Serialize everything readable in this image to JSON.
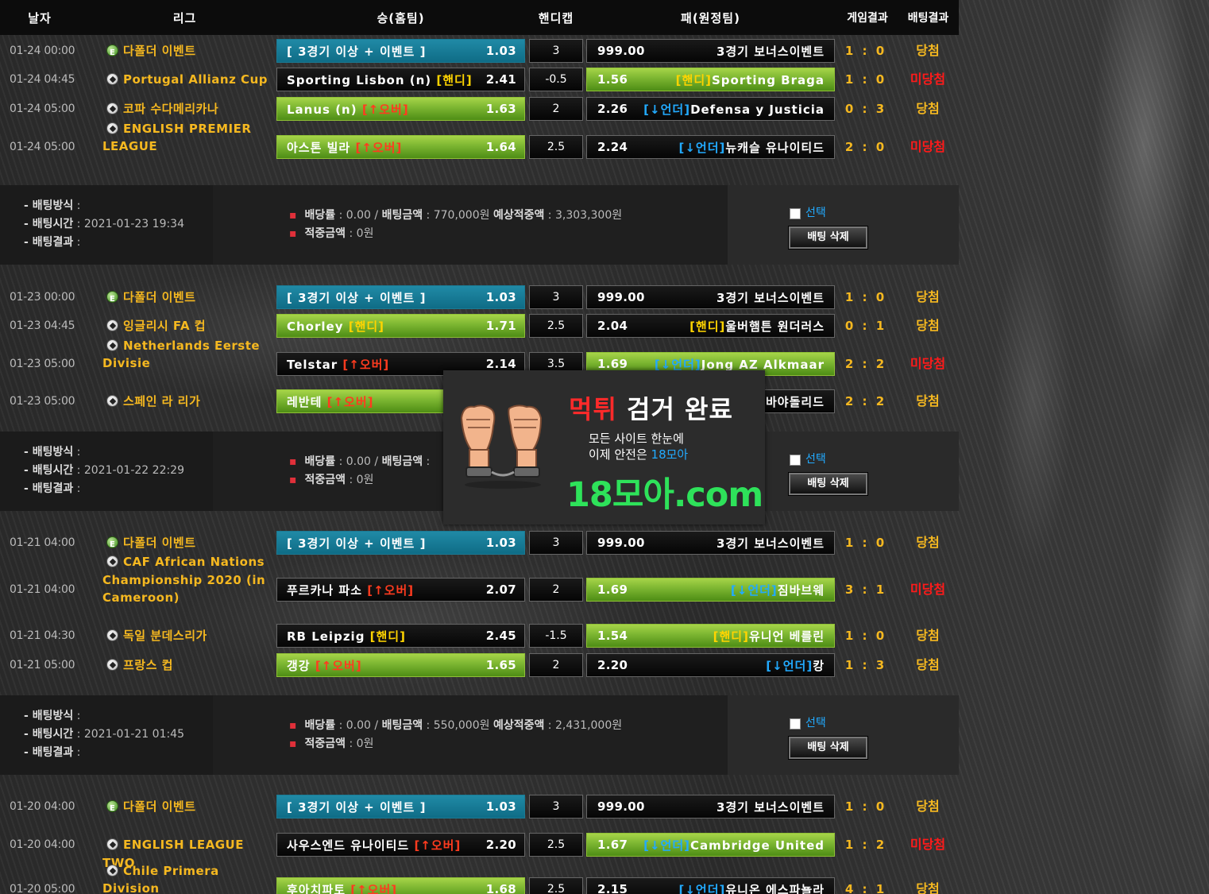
{
  "header": {
    "date": "날자",
    "league": "리그",
    "home": "승(홈팀)",
    "handicap": "핸디캡",
    "away": "패(원정팀)",
    "game_result": "게임결과",
    "bet_result": "배팅결과"
  },
  "groups": [
    {
      "rows": [
        {
          "date": "01-24 00:00",
          "league": "다폴더 이벤트",
          "icon": "event",
          "home": "[ 3경기 이상 + 이벤트 ]",
          "home_tag": "",
          "home_tag_color": "",
          "home_odds": "1.03",
          "home_style": "blue",
          "hc": "3",
          "away_odds": "999.00",
          "away_tag": "",
          "away_tag_color": "",
          "away": "3경기 보너스이벤트",
          "away_style": "plain",
          "score": "1 : 0",
          "outcome": "당첨",
          "outcome_type": "win"
        },
        {
          "date": "01-24 04:45",
          "league": "Portugal Allianz Cup",
          "icon": "ball",
          "home": "Sporting Lisbon (n) ",
          "home_tag": "[핸디]",
          "home_tag_color": "y",
          "home_odds": "2.41",
          "home_style": "plain",
          "hc": "-0.5",
          "away_odds": "1.56",
          "away_tag": "[핸디]",
          "away_tag_color": "y",
          "away": "Sporting Braga",
          "away_style": "green",
          "score": "1 : 0",
          "outcome": "미당첨",
          "outcome_type": "lose"
        },
        {
          "date": "01-24 05:00",
          "league": "코파 수다메리카나",
          "icon": "ball",
          "home": "Lanus (n) ",
          "home_tag": "[↑오버]",
          "home_tag_color": "r",
          "home_odds": "1.63",
          "home_style": "green",
          "hc": "2",
          "away_odds": "2.26",
          "away_tag": "[↓언더]",
          "away_tag_color": "b",
          "away": "Defensa y Justicia",
          "away_style": "plain",
          "score": "0 : 3",
          "outcome": "당첨",
          "outcome_type": "win"
        },
        {
          "date": "01-24 05:00",
          "league": "ENGLISH PREMIER LEAGUE",
          "icon": "ball",
          "home": "아스톤 빌라 ",
          "home_tag": "[↑오버]",
          "home_tag_color": "r",
          "home_odds": "1.64",
          "home_style": "green",
          "hc": "2.5",
          "away_odds": "2.24",
          "away_tag": "[↓언더]",
          "away_tag_color": "b",
          "away": "뉴캐슬 유나이티드",
          "away_style": "plain",
          "score": "2 : 0",
          "outcome": "미당첨",
          "outcome_type": "lose"
        }
      ],
      "summary": {
        "method_label": "배팅방식",
        "method": "",
        "time_label": "배팅시간",
        "time": "2021-01-23 19:34",
        "result_label": "배팅결과",
        "result": "",
        "rate_label": "배당률",
        "rate": "0.00",
        "amount_label": "배팅금액",
        "amount": "770,000원",
        "expect_label": "예상적중액",
        "expect": "3,303,300원",
        "hit_label": "적중금액",
        "hit": "0원",
        "select_label": "선택",
        "delete_label": "배팅 삭제"
      }
    },
    {
      "rows": [
        {
          "date": "01-23 00:00",
          "league": "다폴더 이벤트",
          "icon": "event",
          "home": "[ 3경기 이상 + 이벤트 ]",
          "home_tag": "",
          "home_tag_color": "",
          "home_odds": "1.03",
          "home_style": "blue",
          "hc": "3",
          "away_odds": "999.00",
          "away_tag": "",
          "away_tag_color": "",
          "away": "3경기 보너스이벤트",
          "away_style": "plain",
          "score": "1 : 0",
          "outcome": "당첨",
          "outcome_type": "win"
        },
        {
          "date": "01-23 04:45",
          "league": "잉글리시 FA 컵",
          "icon": "ball",
          "home": "Chorley ",
          "home_tag": "[핸디]",
          "home_tag_color": "y",
          "home_odds": "1.71",
          "home_style": "green",
          "hc": "2.5",
          "away_odds": "2.04",
          "away_tag": "[핸디]",
          "away_tag_color": "y",
          "away": "울버햄튼 원더러스",
          "away_style": "plain",
          "score": "0 : 1",
          "outcome": "당첨",
          "outcome_type": "win"
        },
        {
          "date": "01-23 05:00",
          "league": "Netherlands Eerste Divisie",
          "icon": "ball",
          "home": "Telstar ",
          "home_tag": "[↑오버]",
          "home_tag_color": "r",
          "home_odds": "2.14",
          "home_style": "plain",
          "hc": "3.5",
          "away_odds": "1.69",
          "away_tag": "[↓언더]",
          "away_tag_color": "b",
          "away": "Jong AZ Alkmaar",
          "away_style": "green",
          "score": "2 : 2",
          "outcome": "미당첨",
          "outcome_type": "lose"
        },
        {
          "date": "01-23 05:00",
          "league": "스페인 라 리가",
          "icon": "ball",
          "home": "레반테 ",
          "home_tag": "[↑오버]",
          "home_tag_color": "r",
          "home_odds": "",
          "home_style": "green",
          "hc": "",
          "away_odds": "",
          "away_tag": "",
          "away_tag_color": "",
          "away": "바야돌리드",
          "away_style": "plain",
          "score": "2 : 2",
          "outcome": "당첨",
          "outcome_type": "win"
        }
      ],
      "summary": {
        "method_label": "배팅방식",
        "method": "",
        "time_label": "배팅시간",
        "time": "2021-01-22 22:29",
        "result_label": "배팅결과",
        "result": "",
        "rate_label": "배당률",
        "rate": "0.00",
        "amount_label": "배팅금액",
        "amount": "",
        "expect_label": "",
        "expect": "",
        "hit_label": "적중금액",
        "hit": "0원",
        "select_label": "선택",
        "delete_label": "배팅 삭제"
      }
    },
    {
      "rows": [
        {
          "date": "01-21 04:00",
          "league": "다폴더 이벤트",
          "icon": "event",
          "home": "[ 3경기 이상 + 이벤트 ]",
          "home_tag": "",
          "home_tag_color": "",
          "home_odds": "1.03",
          "home_style": "blue",
          "hc": "3",
          "away_odds": "999.00",
          "away_tag": "",
          "away_tag_color": "",
          "away": "3경기 보너스이벤트",
          "away_style": "plain",
          "score": "1 : 0",
          "outcome": "당첨",
          "outcome_type": "win"
        },
        {
          "date": "01-21 04:00",
          "league": "CAF African Nations Championship 2020 (in Cameroon)",
          "icon": "ball",
          "home": "푸르카나 파소 ",
          "home_tag": "[↑오버]",
          "home_tag_color": "r",
          "home_odds": "2.07",
          "home_style": "plain",
          "hc": "2",
          "away_odds": "1.69",
          "away_tag": "[↓언더]",
          "away_tag_color": "b",
          "away": "짐바브웨",
          "away_style": "green",
          "score": "3 : 1",
          "outcome": "미당첨",
          "outcome_type": "lose"
        },
        {
          "date": "01-21 04:30",
          "league": "독일 분데스리가",
          "icon": "ball",
          "home": "RB Leipzig ",
          "home_tag": "[핸디]",
          "home_tag_color": "y",
          "home_odds": "2.45",
          "home_style": "plain",
          "hc": "-1.5",
          "away_odds": "1.54",
          "away_tag": "[핸디]",
          "away_tag_color": "y",
          "away": "유니언 베를린",
          "away_style": "green",
          "score": "1 : 0",
          "outcome": "당첨",
          "outcome_type": "win"
        },
        {
          "date": "01-21 05:00",
          "league": "프랑스 컵",
          "icon": "ball",
          "home": "갱강 ",
          "home_tag": "[↑오버]",
          "home_tag_color": "r",
          "home_odds": "1.65",
          "home_style": "green",
          "hc": "2",
          "away_odds": "2.20",
          "away_tag": "[↓언더]",
          "away_tag_color": "b",
          "away": "캉",
          "away_style": "plain",
          "score": "1 : 3",
          "outcome": "당첨",
          "outcome_type": "win"
        }
      ],
      "summary": {
        "method_label": "배팅방식",
        "method": "",
        "time_label": "배팅시간",
        "time": "2021-01-21 01:45",
        "result_label": "배팅결과",
        "result": "",
        "rate_label": "배당률",
        "rate": "0.00",
        "amount_label": "배팅금액",
        "amount": "550,000원",
        "expect_label": "예상적중액",
        "expect": "2,431,000원",
        "hit_label": "적중금액",
        "hit": "0원",
        "select_label": "선택",
        "delete_label": "배팅 삭제"
      }
    },
    {
      "rows": [
        {
          "date": "01-20 04:00",
          "league": "다폴더 이벤트",
          "icon": "event",
          "home": "[ 3경기 이상 + 이벤트 ]",
          "home_tag": "",
          "home_tag_color": "",
          "home_odds": "1.03",
          "home_style": "blue",
          "hc": "3",
          "away_odds": "999.00",
          "away_tag": "",
          "away_tag_color": "",
          "away": "3경기 보너스이벤트",
          "away_style": "plain",
          "score": "1 : 0",
          "outcome": "당첨",
          "outcome_type": "win"
        },
        {
          "date": "01-20 04:00",
          "league": "ENGLISH LEAGUE TWO",
          "icon": "ball",
          "home": "사우스엔드 유나이티드 ",
          "home_tag": "[↑오버]",
          "home_tag_color": "r",
          "home_odds": "2.20",
          "home_style": "plain",
          "hc": "2.5",
          "away_odds": "1.67",
          "away_tag": "[↓언더]",
          "away_tag_color": "b",
          "away": "Cambridge United",
          "away_style": "green",
          "score": "1 : 2",
          "outcome": "미당첨",
          "outcome_type": "lose"
        },
        {
          "date": "01-20 05:00",
          "league": "Chile Primera Division",
          "icon": "ball",
          "home": "후아치파토 ",
          "home_tag": "[↑오버]",
          "home_tag_color": "r",
          "home_odds": "1.68",
          "home_style": "green",
          "hc": "2.5",
          "away_odds": "2.15",
          "away_tag": "[↓언더]",
          "away_tag_color": "b",
          "away": "유니온 에스파뇰라",
          "away_style": "plain",
          "score": "4 : 1",
          "outcome": "당첨",
          "outcome_type": "win"
        }
      ],
      "summary": null
    }
  ],
  "popup": {
    "title_red": "먹튀",
    "title_rest": " 검거 완료",
    "line1": "모든 사이트 한눈에",
    "line2_pre": "이제 안전은 ",
    "line2_blue": "18모아",
    "site": "18모아.com"
  }
}
